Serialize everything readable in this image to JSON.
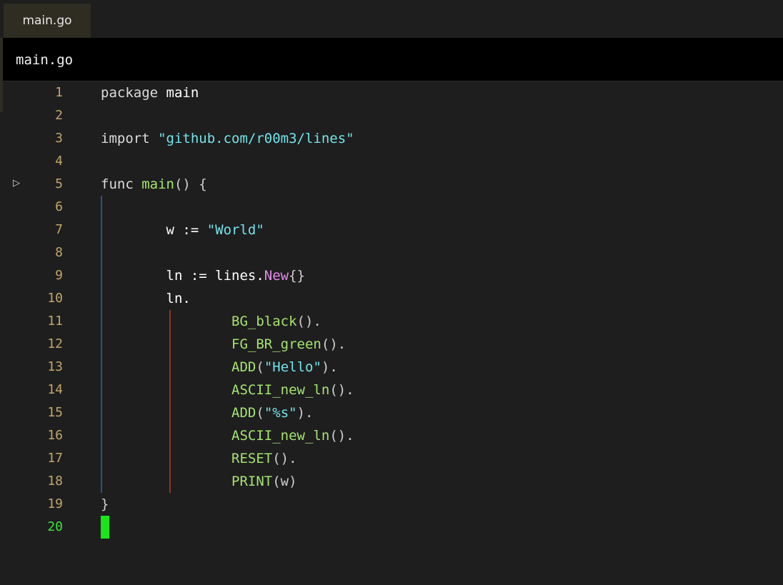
{
  "tab": {
    "label": "main.go"
  },
  "file_header": {
    "title": "main.go"
  },
  "editor": {
    "current_line": 20,
    "lines": [
      {
        "num": "1",
        "tokens": [
          {
            "t": "package ",
            "c": "kw"
          },
          {
            "t": "main",
            "c": "id"
          }
        ]
      },
      {
        "num": "2",
        "tokens": []
      },
      {
        "num": "3",
        "tokens": [
          {
            "t": "import ",
            "c": "kw"
          },
          {
            "t": "\"github.com/r00m3/lines\"",
            "c": "str"
          }
        ]
      },
      {
        "num": "4",
        "tokens": []
      },
      {
        "num": "5",
        "tokens": [
          {
            "t": "func ",
            "c": "kw"
          },
          {
            "t": "main",
            "c": "fn"
          },
          {
            "t": "() {",
            "c": "pun"
          }
        ],
        "run_marker": "▷"
      },
      {
        "num": "6",
        "tokens": []
      },
      {
        "num": "7",
        "tokens": [
          {
            "t": "        w := ",
            "c": "id"
          },
          {
            "t": "\"World\"",
            "c": "str"
          }
        ]
      },
      {
        "num": "8",
        "tokens": []
      },
      {
        "num": "9",
        "tokens": [
          {
            "t": "        ln := lines.",
            "c": "id"
          },
          {
            "t": "New",
            "c": "method"
          },
          {
            "t": "{}",
            "c": "pun"
          }
        ]
      },
      {
        "num": "10",
        "tokens": [
          {
            "t": "        ln.",
            "c": "id"
          }
        ]
      },
      {
        "num": "11",
        "tokens": [
          {
            "t": "                ",
            "c": "id"
          },
          {
            "t": "BG_black",
            "c": "fn"
          },
          {
            "t": "().",
            "c": "pun"
          }
        ]
      },
      {
        "num": "12",
        "tokens": [
          {
            "t": "                ",
            "c": "id"
          },
          {
            "t": "FG_BR_green",
            "c": "fn"
          },
          {
            "t": "().",
            "c": "pun"
          }
        ]
      },
      {
        "num": "13",
        "tokens": [
          {
            "t": "                ",
            "c": "id"
          },
          {
            "t": "ADD",
            "c": "fn"
          },
          {
            "t": "(",
            "c": "pun"
          },
          {
            "t": "\"Hello\"",
            "c": "str"
          },
          {
            "t": ").",
            "c": "pun"
          }
        ]
      },
      {
        "num": "14",
        "tokens": [
          {
            "t": "                ",
            "c": "id"
          },
          {
            "t": "ASCII_new_ln",
            "c": "fn"
          },
          {
            "t": "().",
            "c": "pun"
          }
        ]
      },
      {
        "num": "15",
        "tokens": [
          {
            "t": "                ",
            "c": "id"
          },
          {
            "t": "ADD",
            "c": "fn"
          },
          {
            "t": "(",
            "c": "pun"
          },
          {
            "t": "\"%s\"",
            "c": "str"
          },
          {
            "t": ").",
            "c": "pun"
          }
        ]
      },
      {
        "num": "16",
        "tokens": [
          {
            "t": "                ",
            "c": "id"
          },
          {
            "t": "ASCII_new_ln",
            "c": "fn"
          },
          {
            "t": "().",
            "c": "pun"
          }
        ]
      },
      {
        "num": "17",
        "tokens": [
          {
            "t": "                ",
            "c": "id"
          },
          {
            "t": "RESET",
            "c": "fn"
          },
          {
            "t": "().",
            "c": "pun"
          }
        ]
      },
      {
        "num": "18",
        "tokens": [
          {
            "t": "                ",
            "c": "id"
          },
          {
            "t": "PRINT",
            "c": "fn"
          },
          {
            "t": "(w)",
            "c": "pun"
          }
        ]
      },
      {
        "num": "19",
        "tokens": [
          {
            "t": "}",
            "c": "pun"
          }
        ]
      },
      {
        "num": "20",
        "tokens": []
      }
    ]
  },
  "colors": {
    "background": "#1e1e1e",
    "line_number": "#c2a56c",
    "current_line_number": "#3ee33e",
    "function": "#a6e371",
    "string": "#74e3ea",
    "method": "#e58ce8",
    "cursor": "#19e619"
  },
  "icons": {
    "run_marker": "run-triangle-icon"
  }
}
